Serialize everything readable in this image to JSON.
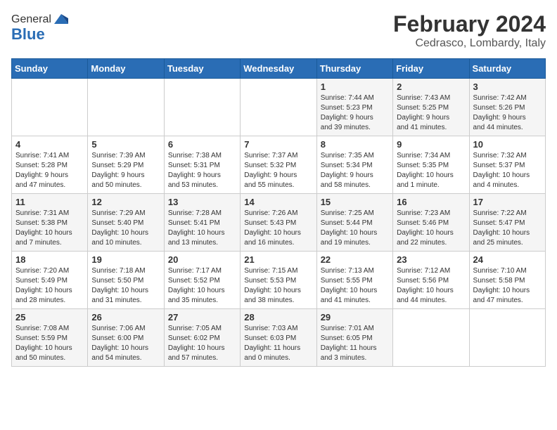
{
  "header": {
    "logo_general": "General",
    "logo_blue": "Blue",
    "month_year": "February 2024",
    "location": "Cedrasco, Lombardy, Italy"
  },
  "calendar": {
    "days_of_week": [
      "Sunday",
      "Monday",
      "Tuesday",
      "Wednesday",
      "Thursday",
      "Friday",
      "Saturday"
    ],
    "weeks": [
      [
        {
          "day": "",
          "info": ""
        },
        {
          "day": "",
          "info": ""
        },
        {
          "day": "",
          "info": ""
        },
        {
          "day": "",
          "info": ""
        },
        {
          "day": "1",
          "info": "Sunrise: 7:44 AM\nSunset: 5:23 PM\nDaylight: 9 hours\nand 39 minutes."
        },
        {
          "day": "2",
          "info": "Sunrise: 7:43 AM\nSunset: 5:25 PM\nDaylight: 9 hours\nand 41 minutes."
        },
        {
          "day": "3",
          "info": "Sunrise: 7:42 AM\nSunset: 5:26 PM\nDaylight: 9 hours\nand 44 minutes."
        }
      ],
      [
        {
          "day": "4",
          "info": "Sunrise: 7:41 AM\nSunset: 5:28 PM\nDaylight: 9 hours\nand 47 minutes."
        },
        {
          "day": "5",
          "info": "Sunrise: 7:39 AM\nSunset: 5:29 PM\nDaylight: 9 hours\nand 50 minutes."
        },
        {
          "day": "6",
          "info": "Sunrise: 7:38 AM\nSunset: 5:31 PM\nDaylight: 9 hours\nand 53 minutes."
        },
        {
          "day": "7",
          "info": "Sunrise: 7:37 AM\nSunset: 5:32 PM\nDaylight: 9 hours\nand 55 minutes."
        },
        {
          "day": "8",
          "info": "Sunrise: 7:35 AM\nSunset: 5:34 PM\nDaylight: 9 hours\nand 58 minutes."
        },
        {
          "day": "9",
          "info": "Sunrise: 7:34 AM\nSunset: 5:35 PM\nDaylight: 10 hours\nand 1 minute."
        },
        {
          "day": "10",
          "info": "Sunrise: 7:32 AM\nSunset: 5:37 PM\nDaylight: 10 hours\nand 4 minutes."
        }
      ],
      [
        {
          "day": "11",
          "info": "Sunrise: 7:31 AM\nSunset: 5:38 PM\nDaylight: 10 hours\nand 7 minutes."
        },
        {
          "day": "12",
          "info": "Sunrise: 7:29 AM\nSunset: 5:40 PM\nDaylight: 10 hours\nand 10 minutes."
        },
        {
          "day": "13",
          "info": "Sunrise: 7:28 AM\nSunset: 5:41 PM\nDaylight: 10 hours\nand 13 minutes."
        },
        {
          "day": "14",
          "info": "Sunrise: 7:26 AM\nSunset: 5:43 PM\nDaylight: 10 hours\nand 16 minutes."
        },
        {
          "day": "15",
          "info": "Sunrise: 7:25 AM\nSunset: 5:44 PM\nDaylight: 10 hours\nand 19 minutes."
        },
        {
          "day": "16",
          "info": "Sunrise: 7:23 AM\nSunset: 5:46 PM\nDaylight: 10 hours\nand 22 minutes."
        },
        {
          "day": "17",
          "info": "Sunrise: 7:22 AM\nSunset: 5:47 PM\nDaylight: 10 hours\nand 25 minutes."
        }
      ],
      [
        {
          "day": "18",
          "info": "Sunrise: 7:20 AM\nSunset: 5:49 PM\nDaylight: 10 hours\nand 28 minutes."
        },
        {
          "day": "19",
          "info": "Sunrise: 7:18 AM\nSunset: 5:50 PM\nDaylight: 10 hours\nand 31 minutes."
        },
        {
          "day": "20",
          "info": "Sunrise: 7:17 AM\nSunset: 5:52 PM\nDaylight: 10 hours\nand 35 minutes."
        },
        {
          "day": "21",
          "info": "Sunrise: 7:15 AM\nSunset: 5:53 PM\nDaylight: 10 hours\nand 38 minutes."
        },
        {
          "day": "22",
          "info": "Sunrise: 7:13 AM\nSunset: 5:55 PM\nDaylight: 10 hours\nand 41 minutes."
        },
        {
          "day": "23",
          "info": "Sunrise: 7:12 AM\nSunset: 5:56 PM\nDaylight: 10 hours\nand 44 minutes."
        },
        {
          "day": "24",
          "info": "Sunrise: 7:10 AM\nSunset: 5:58 PM\nDaylight: 10 hours\nand 47 minutes."
        }
      ],
      [
        {
          "day": "25",
          "info": "Sunrise: 7:08 AM\nSunset: 5:59 PM\nDaylight: 10 hours\nand 50 minutes."
        },
        {
          "day": "26",
          "info": "Sunrise: 7:06 AM\nSunset: 6:00 PM\nDaylight: 10 hours\nand 54 minutes."
        },
        {
          "day": "27",
          "info": "Sunrise: 7:05 AM\nSunset: 6:02 PM\nDaylight: 10 hours\nand 57 minutes."
        },
        {
          "day": "28",
          "info": "Sunrise: 7:03 AM\nSunset: 6:03 PM\nDaylight: 11 hours\nand 0 minutes."
        },
        {
          "day": "29",
          "info": "Sunrise: 7:01 AM\nSunset: 6:05 PM\nDaylight: 11 hours\nand 3 minutes."
        },
        {
          "day": "",
          "info": ""
        },
        {
          "day": "",
          "info": ""
        }
      ]
    ]
  }
}
